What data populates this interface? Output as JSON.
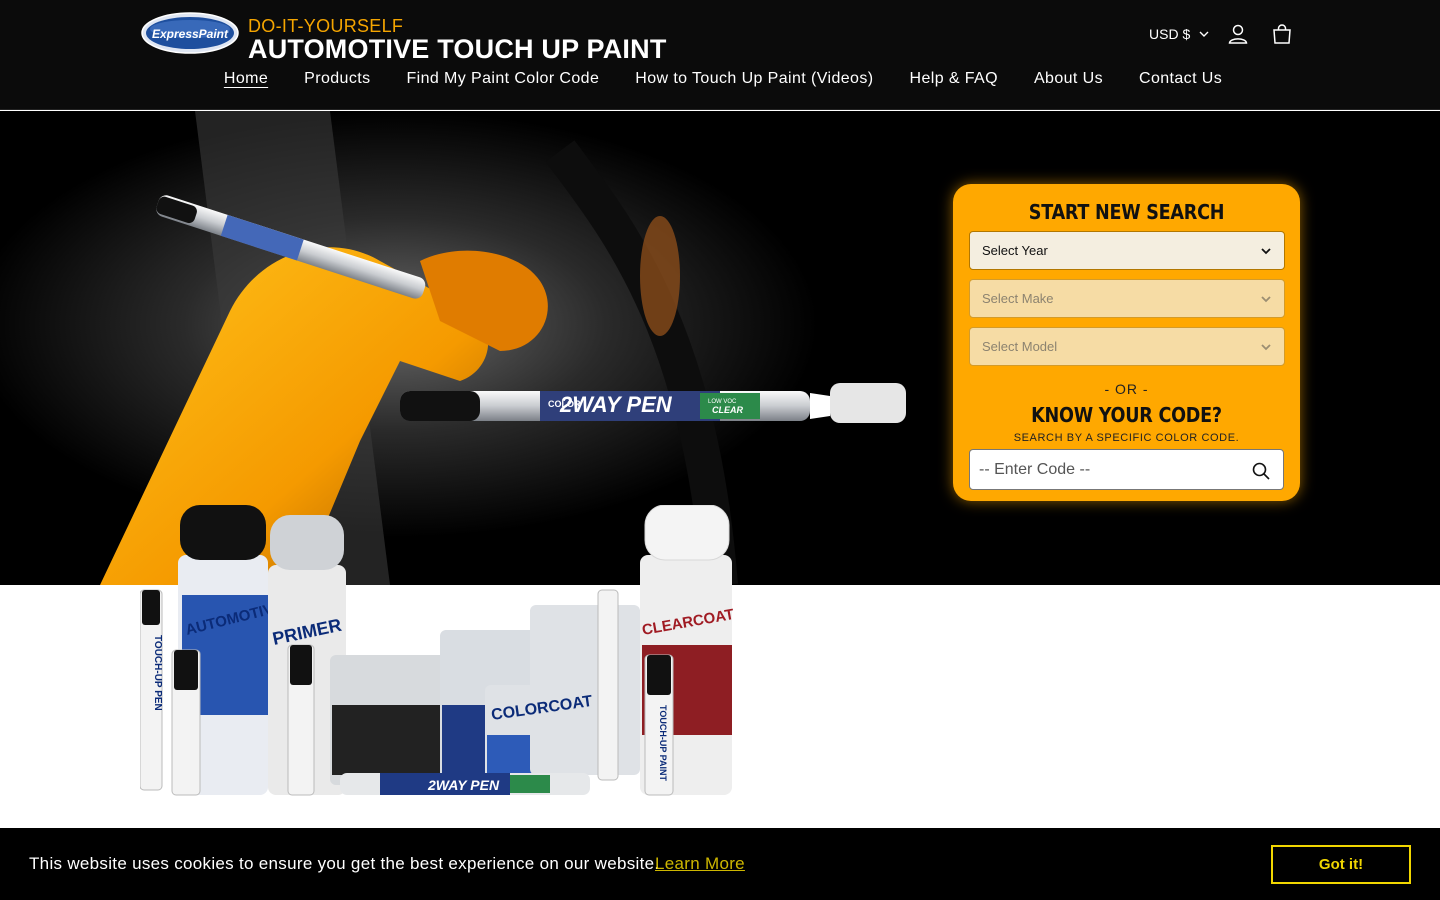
{
  "header": {
    "logo_alt": "ExpressPaint",
    "tagline": "DO-IT-YOURSELF",
    "title": "AUTOMOTIVE TOUCH UP PAINT",
    "currency": "USD $",
    "account_icon": "user-icon",
    "cart_icon": "bag-icon"
  },
  "nav": {
    "items": [
      {
        "label": "Home",
        "active": true
      },
      {
        "label": "Products"
      },
      {
        "label": "Find My Paint Color Code"
      },
      {
        "label": "How to Touch Up Paint (Videos)"
      },
      {
        "label": "Help & FAQ"
      },
      {
        "label": "About Us"
      },
      {
        "label": "Contact Us"
      }
    ]
  },
  "hero": {
    "pen_band_text": "COLOR",
    "pen_brand": "2WAY PEN",
    "pen_clear": "CLEAR",
    "pen_lowvoc": "LOW VOC"
  },
  "search": {
    "title": "START NEW SEARCH",
    "year_placeholder": "Select Year",
    "make_placeholder": "Select Make",
    "model_placeholder": "Select Model",
    "or_text": "- OR -",
    "code_title": "KNOW YOUR CODE?",
    "code_subtitle": "SEARCH BY A SPECIFIC COLOR CODE.",
    "code_placeholder": "-- Enter Code --"
  },
  "products_image": {
    "labels": [
      "AUTOMOTIVE",
      "PRIMER",
      "CLEARCOAT",
      "TOUCH-UP PEN",
      "TOUCH-UP PAINT",
      "COLORCOAT",
      "2WAY PEN"
    ]
  },
  "cookie": {
    "message": "This website uses cookies to ensure you get the best experience on our website.",
    "link": "Learn More",
    "button": "Got it!"
  },
  "colors": {
    "accent": "#ffa800",
    "tagline": "#f5a500",
    "cookie_button": "#f1d600",
    "header_bg": "#0b0b0b"
  }
}
